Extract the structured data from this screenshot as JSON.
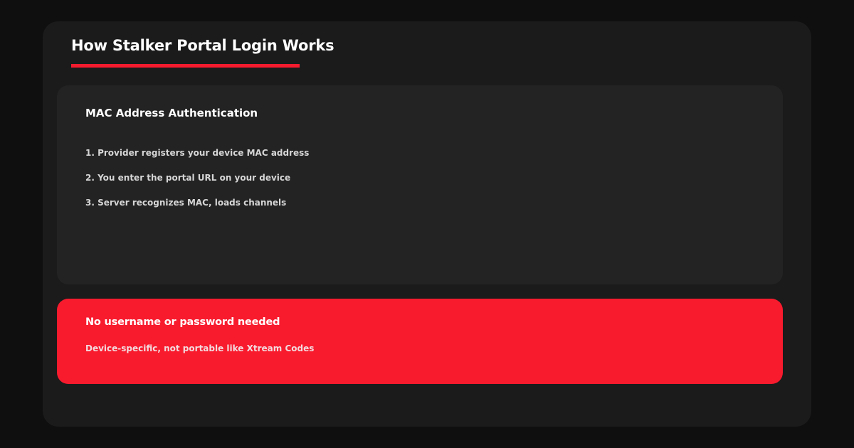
{
  "header": {
    "title": "How Stalker Portal Login Works"
  },
  "card": {
    "title": "MAC Address Authentication",
    "steps": [
      "1. Provider registers your device MAC address",
      "2. You enter the portal URL on your device",
      "3. Server recognizes MAC, loads channels"
    ]
  },
  "alert": {
    "title": "No username or password needed",
    "subtitle": "Device-specific, not portable like Xtream Codes"
  },
  "colors": {
    "accent": "#f81b2e",
    "background": "#0f0f0f",
    "panel": "#1b1b1b",
    "card": "#232323"
  }
}
